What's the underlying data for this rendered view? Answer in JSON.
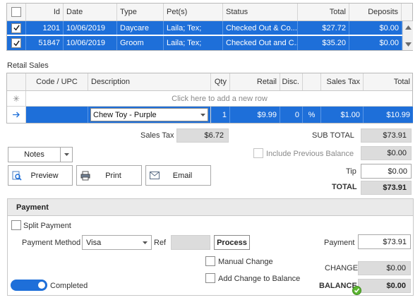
{
  "orders": {
    "columns": {
      "id": "Id",
      "date": "Date",
      "type": "Type",
      "pets": "Pet(s)",
      "status": "Status",
      "total": "Total",
      "deposits": "Deposits"
    },
    "rows": [
      {
        "id": "1201",
        "date": "10/06/2019",
        "type": "Daycare",
        "pets": "Laila; Tex;",
        "status": "Checked Out & Co...",
        "total": "$27.72",
        "deposits": "$0.00"
      },
      {
        "id": "51847",
        "date": "10/06/2019",
        "type": "Groom",
        "pets": "Laila; Tex;",
        "status": "Checked Out and C...",
        "total": "$35.20",
        "deposits": "$0.00"
      }
    ]
  },
  "retail": {
    "section_label": "Retail Sales",
    "columns": {
      "code": "Code / UPC",
      "description": "Description",
      "qty": "Qty",
      "retail": "Retail",
      "disc": "Disc.",
      "sales_tax": "Sales Tax",
      "total": "Total"
    },
    "new_row_hint": "Click here to add a new row",
    "row": {
      "code": "",
      "description": "Chew Toy - Purple",
      "qty": "1",
      "retail": "$9.99",
      "disc": "0",
      "disc_unit": "%",
      "sales_tax": "$1.00",
      "total": "$10.99"
    }
  },
  "summary": {
    "sales_tax_label": "Sales Tax",
    "sales_tax_value": "$6.72",
    "subtotal_label": "SUB TOTAL",
    "subtotal_value": "$73.91",
    "include_prev_label": "Include Previous Balance",
    "include_prev_value": "$0.00",
    "tip_label": "Tip",
    "tip_value": "$0.00",
    "total_label": "TOTAL",
    "total_value": "$73.91"
  },
  "actions": {
    "notes": "Notes",
    "preview": "Preview",
    "print": "Print",
    "email": "Email"
  },
  "payment": {
    "title": "Payment",
    "split_label": "Split Payment",
    "method_label": "Payment Method",
    "method_value": "Visa",
    "ref_label": "Ref",
    "ref_value": "",
    "process_label": "Process",
    "payment_label": "Payment",
    "payment_value": "$73.91",
    "manual_change_label": "Manual Change",
    "add_change_label": "Add Change to Balance",
    "change_label": "CHANGE",
    "change_value": "$0.00",
    "completed_label": "Completed",
    "completed_on": true,
    "balance_label": "BALANCE",
    "balance_value": "$0.00"
  },
  "colors": {
    "selection": "#1e6fd9",
    "toggle": "#1e6fd9",
    "ok_badge": "#5cb531"
  }
}
